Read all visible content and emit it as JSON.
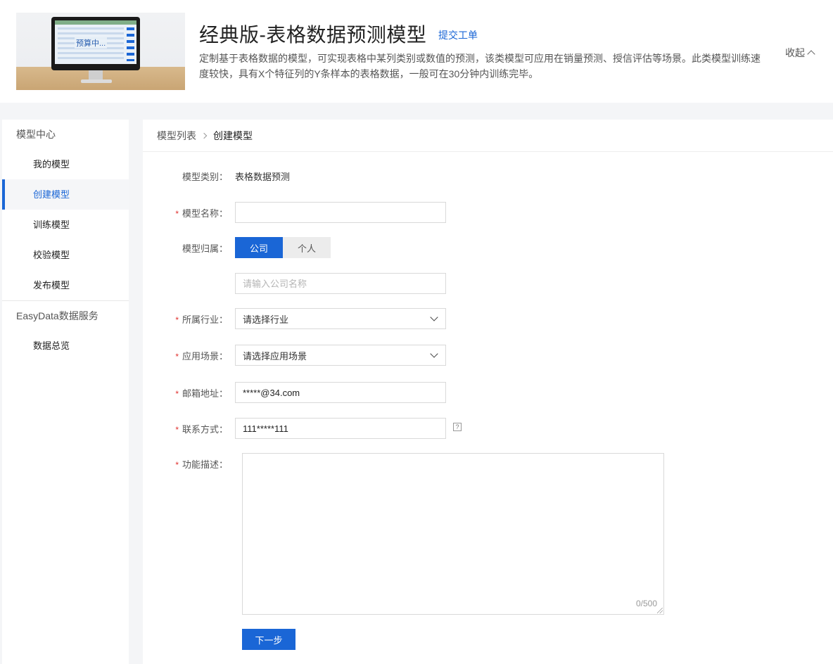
{
  "header": {
    "image_text": "预算中...",
    "title": "经典版-表格数据预测模型",
    "ticket_link": "提交工单",
    "description": "定制基于表格数据的模型，可实现表格中某列类别或数值的预测，该类模型可应用在销量预测、授信评估等场景。此类模型训练速度较快，具有X个特征列的Y条样本的表格数据，一般可在30分钟内训练完毕。",
    "collapse_label": "收起"
  },
  "sidebar": {
    "groups": [
      {
        "title": "模型中心",
        "items": [
          "我的模型",
          "创建模型",
          "训练模型",
          "校验模型",
          "发布模型"
        ]
      },
      {
        "title": "EasyData数据服务",
        "items": [
          "数据总览"
        ]
      }
    ],
    "active_item": "创建模型"
  },
  "breadcrumb": {
    "parent": "模型列表",
    "current": "创建模型"
  },
  "form": {
    "model_type": {
      "label": "模型类别：",
      "value": "表格数据预测"
    },
    "model_name": {
      "label": "模型名称：",
      "value": "",
      "placeholder": ""
    },
    "ownership": {
      "label": "模型归属：",
      "options": [
        "公司",
        "个人"
      ],
      "selected": "公司"
    },
    "company_name": {
      "placeholder": "请输入公司名称"
    },
    "industry": {
      "label": "所属行业：",
      "value": "请选择行业"
    },
    "scenario": {
      "label": "应用场景：",
      "value": "请选择应用场景"
    },
    "email": {
      "label": "邮箱地址：",
      "value": "*****@34.com"
    },
    "contact": {
      "label": "联系方式：",
      "value": "111*****111",
      "help": "?"
    },
    "description": {
      "label": "功能描述：",
      "counter": "0/500"
    },
    "required_mark": "*",
    "next_button": "下一步"
  },
  "colors": {
    "accent": "#1a66d6",
    "required": "#e0322f",
    "page_bg": "#f4f5f7"
  }
}
